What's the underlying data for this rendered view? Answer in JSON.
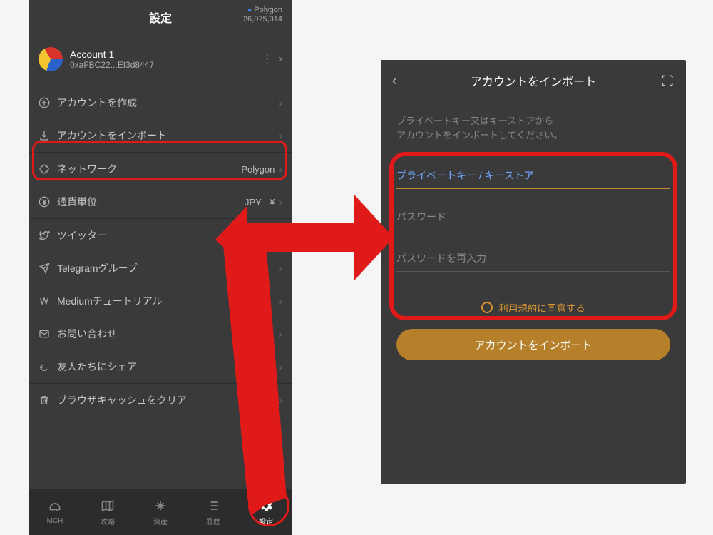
{
  "left": {
    "header": {
      "title": "設定",
      "network_name": "Polygon",
      "block_height": "26,075,014"
    },
    "account": {
      "name": "Account 1",
      "address": "0xaFBC22...Ef3d8447"
    },
    "section1": [
      {
        "key": "create",
        "icon": "plus-circle-icon",
        "label": "アカウントを作成"
      },
      {
        "key": "import",
        "icon": "download-icon",
        "label": "アカウントをインポート"
      }
    ],
    "section2": [
      {
        "key": "network",
        "icon": "puzzle-icon",
        "label": "ネットワーク",
        "value": "Polygon"
      },
      {
        "key": "currency",
        "icon": "yen-icon",
        "label": "通貨単位",
        "value": "JPY - ¥"
      }
    ],
    "section3": [
      {
        "key": "twitter",
        "icon": "twitter-icon",
        "label": "ツイッター"
      },
      {
        "key": "telegram",
        "icon": "send-icon",
        "label": "Telegramグループ"
      },
      {
        "key": "medium",
        "icon": "medium-icon",
        "label": "Mediumチュートリアル"
      },
      {
        "key": "contact",
        "icon": "mail-icon",
        "label": "お問い合わせ"
      },
      {
        "key": "share",
        "icon": "share-icon",
        "label": "友人たちにシェア"
      }
    ],
    "section4": [
      {
        "key": "clear",
        "icon": "trash-icon",
        "label": "ブラウザキャッシュをクリア"
      }
    ],
    "bottom_nav": [
      {
        "key": "mch",
        "label": "MCH"
      },
      {
        "key": "guide",
        "label": "攻略"
      },
      {
        "key": "assets",
        "label": "資産"
      },
      {
        "key": "history",
        "label": "履歴"
      },
      {
        "key": "settings",
        "label": "設定"
      }
    ]
  },
  "right": {
    "header_title": "アカウントをインポート",
    "instruction_line1": "プライベートキー又はキーストアから",
    "instruction_line2": "アカウントをインポートしてください。",
    "field_key_placeholder": "プライベートキー / キーストア",
    "field_pw_placeholder": "パスワード",
    "field_pw2_placeholder": "パスワードを再入力",
    "agree_label": "利用規約に同意する",
    "import_button": "アカウントをインポート"
  }
}
